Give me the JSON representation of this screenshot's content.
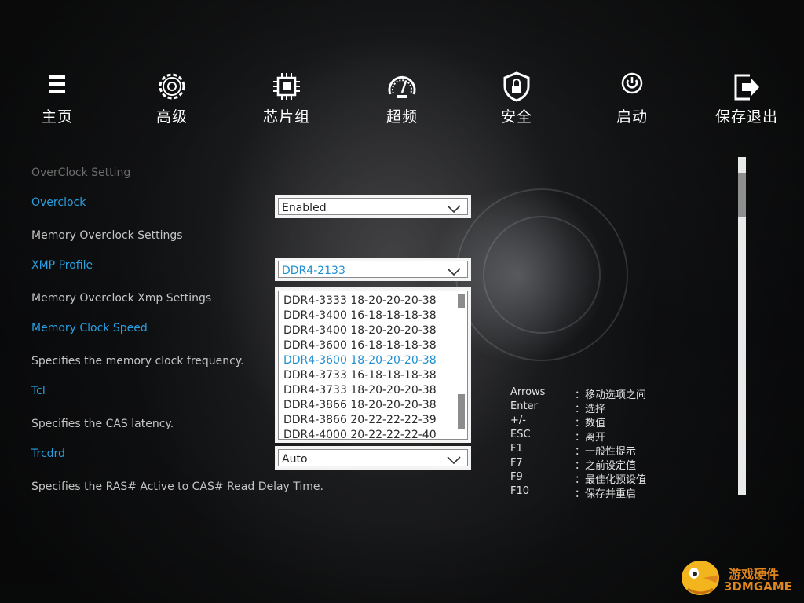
{
  "nav": {
    "items": [
      {
        "label": "主页",
        "icon": "menu-icon"
      },
      {
        "label": "高级",
        "icon": "gear-icon"
      },
      {
        "label": "芯片组",
        "icon": "chip-icon"
      },
      {
        "label": "超频",
        "icon": "speedometer-icon"
      },
      {
        "label": "安全",
        "icon": "shield-lock-icon"
      },
      {
        "label": "启动",
        "icon": "power-icon"
      },
      {
        "label": "保存退出",
        "icon": "exit-icon"
      }
    ]
  },
  "settings": {
    "section_title": "OverClock Setting",
    "overclock_label": "Overclock",
    "overclock_value": "Enabled",
    "mem_oc_settings": "Memory Overclock Settings",
    "xmp_label": "XMP Profile",
    "xmp_value": "DDR4-2133",
    "mem_oc_xmp_settings": "Memory Overclock Xmp Settings",
    "mem_clock_label": "Memory Clock Speed",
    "mem_clock_desc": "Specifies the memory clock frequency.",
    "tcl_label": "Tcl",
    "tcl_desc": "Specifies the CAS latency.",
    "trcdrd_label": "Trcdrd",
    "trcdrd_value": "Auto",
    "trcdrd_desc": "Specifies the RAS# Active to CAS# Read Delay Time."
  },
  "dropdown": {
    "selected_index": 4,
    "options": [
      "DDR4-3333 18-20-20-20-38",
      "DDR4-3400 16-18-18-18-38",
      "DDR4-3400 18-20-20-20-38",
      "DDR4-3600 16-18-18-18-38",
      "DDR4-3600 18-20-20-20-38",
      "DDR4-3733 16-18-18-18-38",
      "DDR4-3733 18-20-20-20-38",
      "DDR4-3866 18-20-20-20-38",
      "DDR4-3866 20-22-22-22-39",
      "DDR4-4000 20-22-22-22-40"
    ]
  },
  "help": [
    {
      "key": "Arrows",
      "desc": "：移动选项之间"
    },
    {
      "key": "Enter",
      "desc": "：选择"
    },
    {
      "key": "+/-",
      "desc": "：数值"
    },
    {
      "key": "ESC",
      "desc": "：离开"
    },
    {
      "key": "F1",
      "desc": "：一般性提示"
    },
    {
      "key": "F7",
      "desc": "：之前设定值"
    },
    {
      "key": "F9",
      "desc": "：最佳化预设值"
    },
    {
      "key": "F10",
      "desc": "：保存并重启"
    }
  ],
  "watermark": {
    "line1": "游戏硬件",
    "line2": "3DMGAME"
  },
  "colors": {
    "accent_blue": "#2a9fe0",
    "selected_blue": "#1e8fd0",
    "watermark_orange": "#e0861c"
  }
}
